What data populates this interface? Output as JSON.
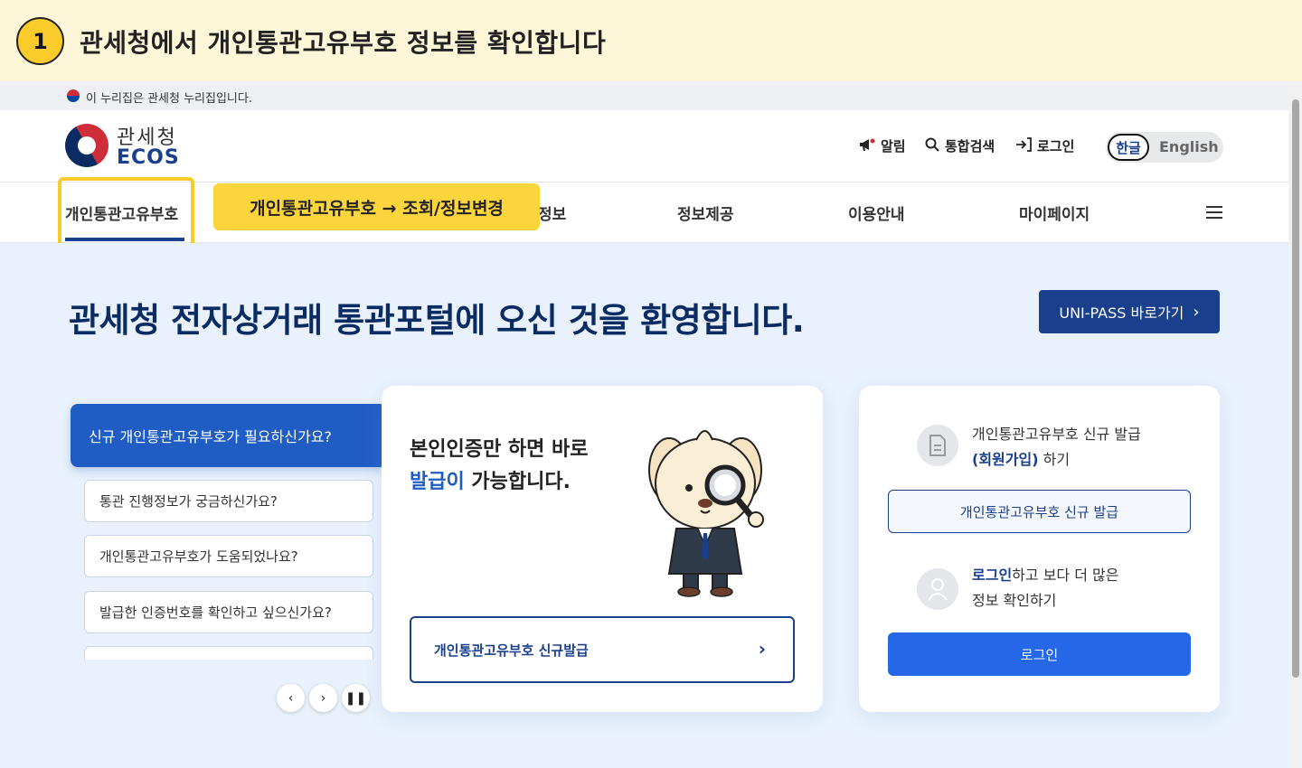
{
  "banner": {
    "step_number": "1",
    "title": "관세청에서 개인통관고유부호 정보를 확인합니다"
  },
  "gov_notice": {
    "text": "이 누리집은 관세청 누리집입니다."
  },
  "header": {
    "logo_ko": "관세청",
    "logo_en": "ECOS",
    "utility": {
      "alarm_label": "알림",
      "search_label": "통합검색",
      "login_label": "로그인"
    },
    "language": {
      "korean": "한글",
      "english": "English"
    }
  },
  "gnb": {
    "items": [
      "개인통관고유부호",
      "정보",
      "정보제공",
      "이용안내",
      "마이페이지"
    ]
  },
  "callout": {
    "text": "개인통관고유부호 → 조회/정보변경"
  },
  "hero": {
    "title": "관세청 전자상거래 통관포털에 오신 것을 환영합니다.",
    "unipass_button": "UNI-PASS 바로가기"
  },
  "tabs": {
    "main": "신규 개인통관고유부호가 필요하신가요?",
    "items": [
      "통관 진행정보가 궁금하신가요?",
      "개인통관고유부호가 도움되었나요?",
      "발급한 인증번호를 확인하고 싶으신가요?"
    ]
  },
  "center_card": {
    "line1": "본인인증만 하면 바로",
    "line2_accent": "발급이",
    "line2_rest": " 가능합니다.",
    "button": "개인통관고유부호 신규발급"
  },
  "right_card": {
    "issue_text_1": "개인통관고유부호 신규 발급",
    "issue_text_2_strong": "(회원가입)",
    "issue_text_2_rest": " 하기",
    "issue_button": "개인통관고유부호 신규 발급",
    "login_text_strong": "로그인",
    "login_text_rest": "하고 보다 더 많은",
    "login_text_2": "정보 확인하기",
    "login_button": "로그인"
  },
  "colors": {
    "banner_bg": "#fdf6d8",
    "highlight": "#f9cb2b",
    "brand_navy": "#1a3f8c",
    "brand_blue": "#2567e6",
    "hero_bg": "#e9f2fc"
  }
}
